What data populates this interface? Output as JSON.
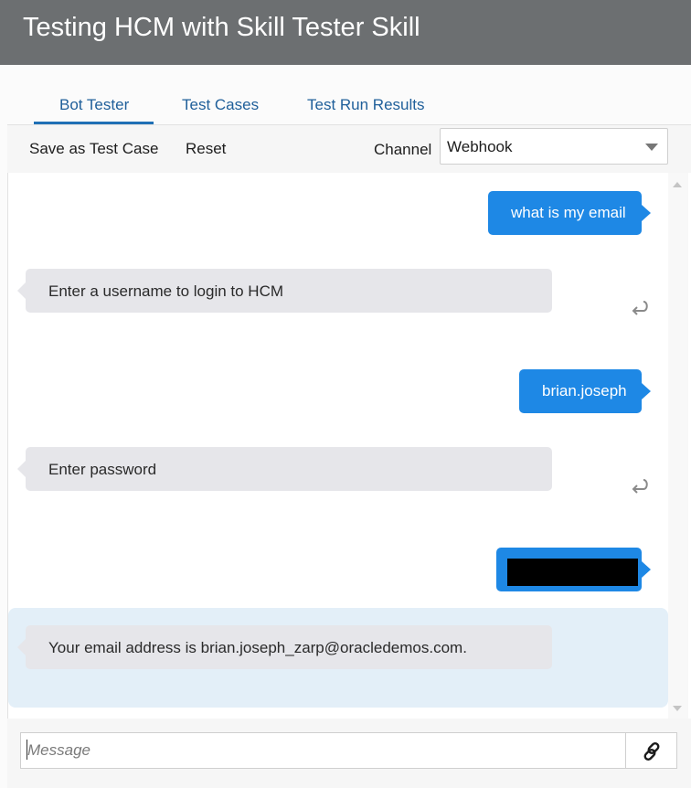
{
  "app": {
    "title": "Testing HCM with Skill Tester Skill"
  },
  "tabs": [
    {
      "label": "Bot Tester",
      "active": true
    },
    {
      "label": "Test Cases",
      "active": false
    },
    {
      "label": "Test Run Results",
      "active": false
    }
  ],
  "toolbar": {
    "save_label": "Save as Test Case",
    "reset_label": "Reset",
    "channel_label": "Channel",
    "channel_value": "Webhook"
  },
  "conversation": {
    "messages": [
      {
        "from": "user",
        "text": "what is my email"
      },
      {
        "from": "bot",
        "text": "Enter a username to login to HCM"
      },
      {
        "from": "user",
        "text": "brian.joseph"
      },
      {
        "from": "bot",
        "text": "Enter password"
      },
      {
        "from": "user",
        "text": "",
        "redacted": true
      },
      {
        "from": "bot",
        "text": "Your email address is brian.joseph_zarp@oracledemos.com.",
        "highlighted": true
      }
    ]
  },
  "composer": {
    "placeholder": "Message",
    "value": ""
  },
  "icons": {
    "reply": "reply-arrow-icon",
    "attach": "link-icon",
    "dropdown": "chevron-down-icon"
  },
  "colors": {
    "titlebar": "#6c6f71",
    "user_bubble": "#1e88e5",
    "bot_bubble": "#e6e6ea",
    "highlight": "#e3eff8",
    "tab_accent": "#1f70b5"
  }
}
